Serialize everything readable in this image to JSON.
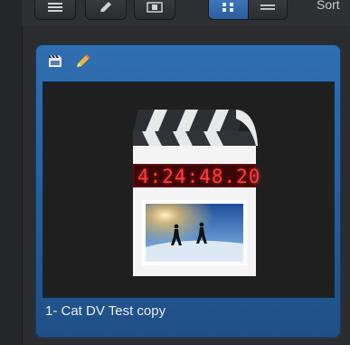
{
  "toolbar": {
    "view_buttons": [
      {
        "name": "list-tool-icon"
      },
      {
        "name": "pencil-tool-icon"
      },
      {
        "name": "film-tool-icon"
      }
    ],
    "segmented": {
      "active": "grid",
      "items": [
        "grid-view-icon",
        "list-view-icon"
      ]
    },
    "label": "Sort"
  },
  "tile": {
    "icons": [
      "clip-icon",
      "pencil-icon"
    ],
    "timecode": "4:24:48.20",
    "caption": "1- Cat DV Test copy"
  },
  "colors": {
    "tile_blue": "#2f6fb1",
    "timecode_red": "#ff3b3b",
    "selected_blue": "#3f7cc0"
  }
}
